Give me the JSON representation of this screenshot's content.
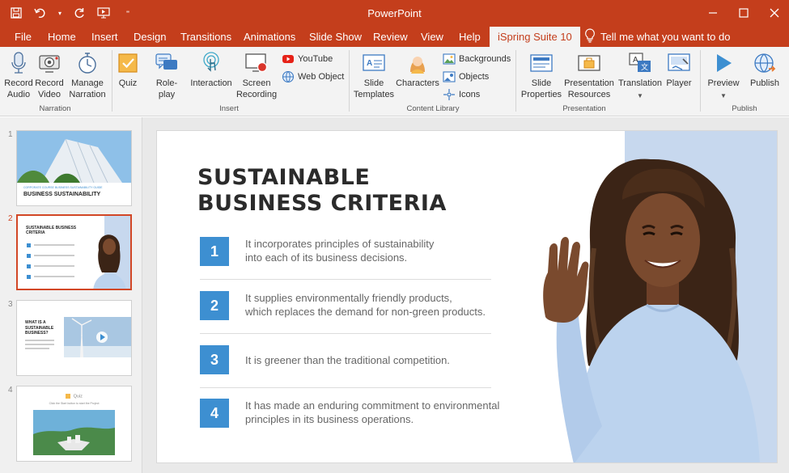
{
  "window": {
    "title": "PowerPoint"
  },
  "tabs": [
    {
      "label": "File"
    },
    {
      "label": "Home"
    },
    {
      "label": "Insert"
    },
    {
      "label": "Design"
    },
    {
      "label": "Transitions"
    },
    {
      "label": "Animations"
    },
    {
      "label": "Slide Show"
    },
    {
      "label": "Review"
    },
    {
      "label": "View"
    },
    {
      "label": "Help"
    },
    {
      "label": "iSpring Suite 10"
    }
  ],
  "tell_me": {
    "placeholder": "Tell me what you want to do"
  },
  "ribbon": {
    "narration": {
      "record_audio": "Record\nAudio",
      "record_video": "Record\nVideo",
      "manage_narration": "Manage\nNarration",
      "group": "Narration"
    },
    "insert": {
      "quiz": "Quiz",
      "role_play": "Role-play",
      "interaction": "Interaction",
      "screen_recording": "Screen\nRecording",
      "youtube": "YouTube",
      "web_object": "Web Object",
      "group": "Insert"
    },
    "content_library": {
      "slide_templates": "Slide\nTemplates",
      "characters": "Characters",
      "backgrounds": "Backgrounds",
      "objects": "Objects",
      "icons": "Icons",
      "group": "Content Library"
    },
    "presentation": {
      "slide_properties": "Slide\nProperties",
      "presentation_resources": "Presentation\nResources",
      "translation": "Translation",
      "player": "Player",
      "group": "Presentation"
    },
    "publish": {
      "preview": "Preview",
      "publish": "Publish",
      "group": "Publish"
    }
  },
  "thumbnails": [
    {
      "num": "1",
      "title": "BUSINESS SUSTAINABILITY",
      "subtitle": "CORPORATE COURSE BUSINESS SUSTAINABILITY GUIDE"
    },
    {
      "num": "2",
      "title": "SUSTAINABLE BUSINESS CRITERIA"
    },
    {
      "num": "3",
      "title": "WHAT IS A SUSTAINABLE BUSINESS?"
    },
    {
      "num": "4",
      "title": "Quiz",
      "subtitle": "Click the Start button to start the Project"
    }
  ],
  "slide": {
    "title_line1": "SUSTAINABLE",
    "title_line2": "BUSINESS CRITERIA",
    "criteria": [
      {
        "num": "1",
        "line1": "It incorporates principles of sustainability",
        "line2": "into each of its business decisions."
      },
      {
        "num": "2",
        "line1": "It supplies environmentally friendly products,",
        "line2": "which replaces the demand for non-green products."
      },
      {
        "num": "3",
        "line1": "It is greener than the traditional competition.",
        "line2": ""
      },
      {
        "num": "4",
        "line1": "It has made an enduring commitment to environmental",
        "line2": "principles in its business operations."
      }
    ]
  },
  "colors": {
    "accent": "#c43e1c",
    "criteria_blue": "#3d8fd1",
    "photo_bg": "#c7d8ee"
  }
}
